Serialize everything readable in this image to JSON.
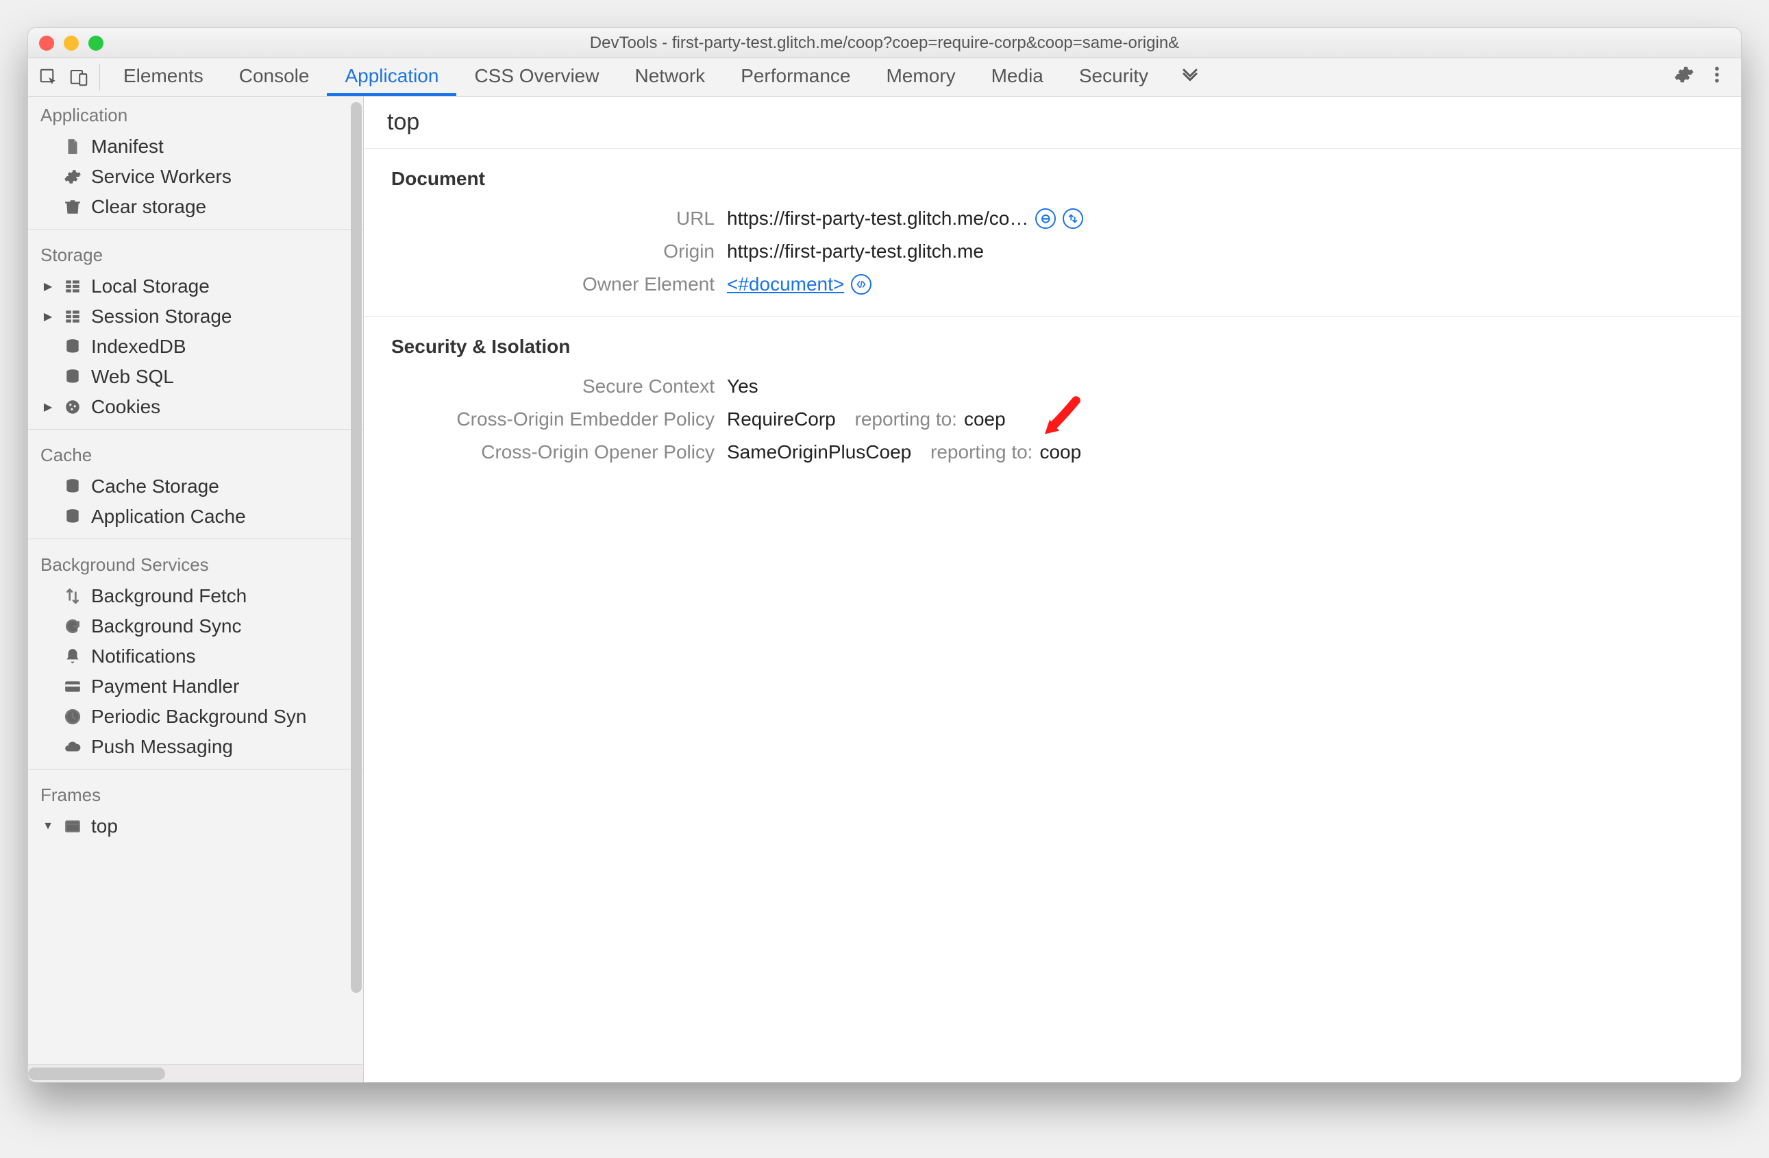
{
  "window": {
    "title": "DevTools - first-party-test.glitch.me/coop?coep=require-corp&coop=same-origin&"
  },
  "tabs": {
    "items": [
      "Elements",
      "Console",
      "Application",
      "CSS Overview",
      "Network",
      "Performance",
      "Memory",
      "Media",
      "Security"
    ],
    "active": "Application"
  },
  "sidebar": {
    "groups": [
      {
        "title": "Application",
        "items": [
          {
            "icon": "file",
            "label": "Manifest"
          },
          {
            "icon": "gear",
            "label": "Service Workers"
          },
          {
            "icon": "trash",
            "label": "Clear storage"
          }
        ]
      },
      {
        "title": "Storage",
        "items": [
          {
            "icon": "grid",
            "label": "Local Storage",
            "caret": true
          },
          {
            "icon": "grid",
            "label": "Session Storage",
            "caret": true
          },
          {
            "icon": "db",
            "label": "IndexedDB"
          },
          {
            "icon": "db",
            "label": "Web SQL"
          },
          {
            "icon": "cookie",
            "label": "Cookies",
            "caret": true
          }
        ]
      },
      {
        "title": "Cache",
        "items": [
          {
            "icon": "db",
            "label": "Cache Storage"
          },
          {
            "icon": "db",
            "label": "Application Cache"
          }
        ]
      },
      {
        "title": "Background Services",
        "items": [
          {
            "icon": "updown",
            "label": "Background Fetch"
          },
          {
            "icon": "sync",
            "label": "Background Sync"
          },
          {
            "icon": "bell",
            "label": "Notifications"
          },
          {
            "icon": "card",
            "label": "Payment Handler"
          },
          {
            "icon": "clock",
            "label": "Periodic Background Syn"
          },
          {
            "icon": "cloud",
            "label": "Push Messaging"
          }
        ]
      },
      {
        "title": "Frames",
        "items": [
          {
            "icon": "frame",
            "label": "top",
            "caret_down": true
          }
        ]
      }
    ]
  },
  "main": {
    "title": "top",
    "document": {
      "heading": "Document",
      "url_key": "URL",
      "url_val": "https://first-party-test.glitch.me/co…",
      "origin_key": "Origin",
      "origin_val": "https://first-party-test.glitch.me",
      "owner_key": "Owner Element",
      "owner_val": "<#document>"
    },
    "security": {
      "heading": "Security & Isolation",
      "secure_key": "Secure Context",
      "secure_val": "Yes",
      "coep_key": "Cross-Origin Embedder Policy",
      "coep_val": "RequireCorp",
      "coep_report_lbl": "reporting to:",
      "coep_report_val": "coep",
      "coop_key": "Cross-Origin Opener Policy",
      "coop_val": "SameOriginPlusCoep",
      "coop_report_lbl": "reporting to:",
      "coop_report_val": "coop"
    }
  }
}
